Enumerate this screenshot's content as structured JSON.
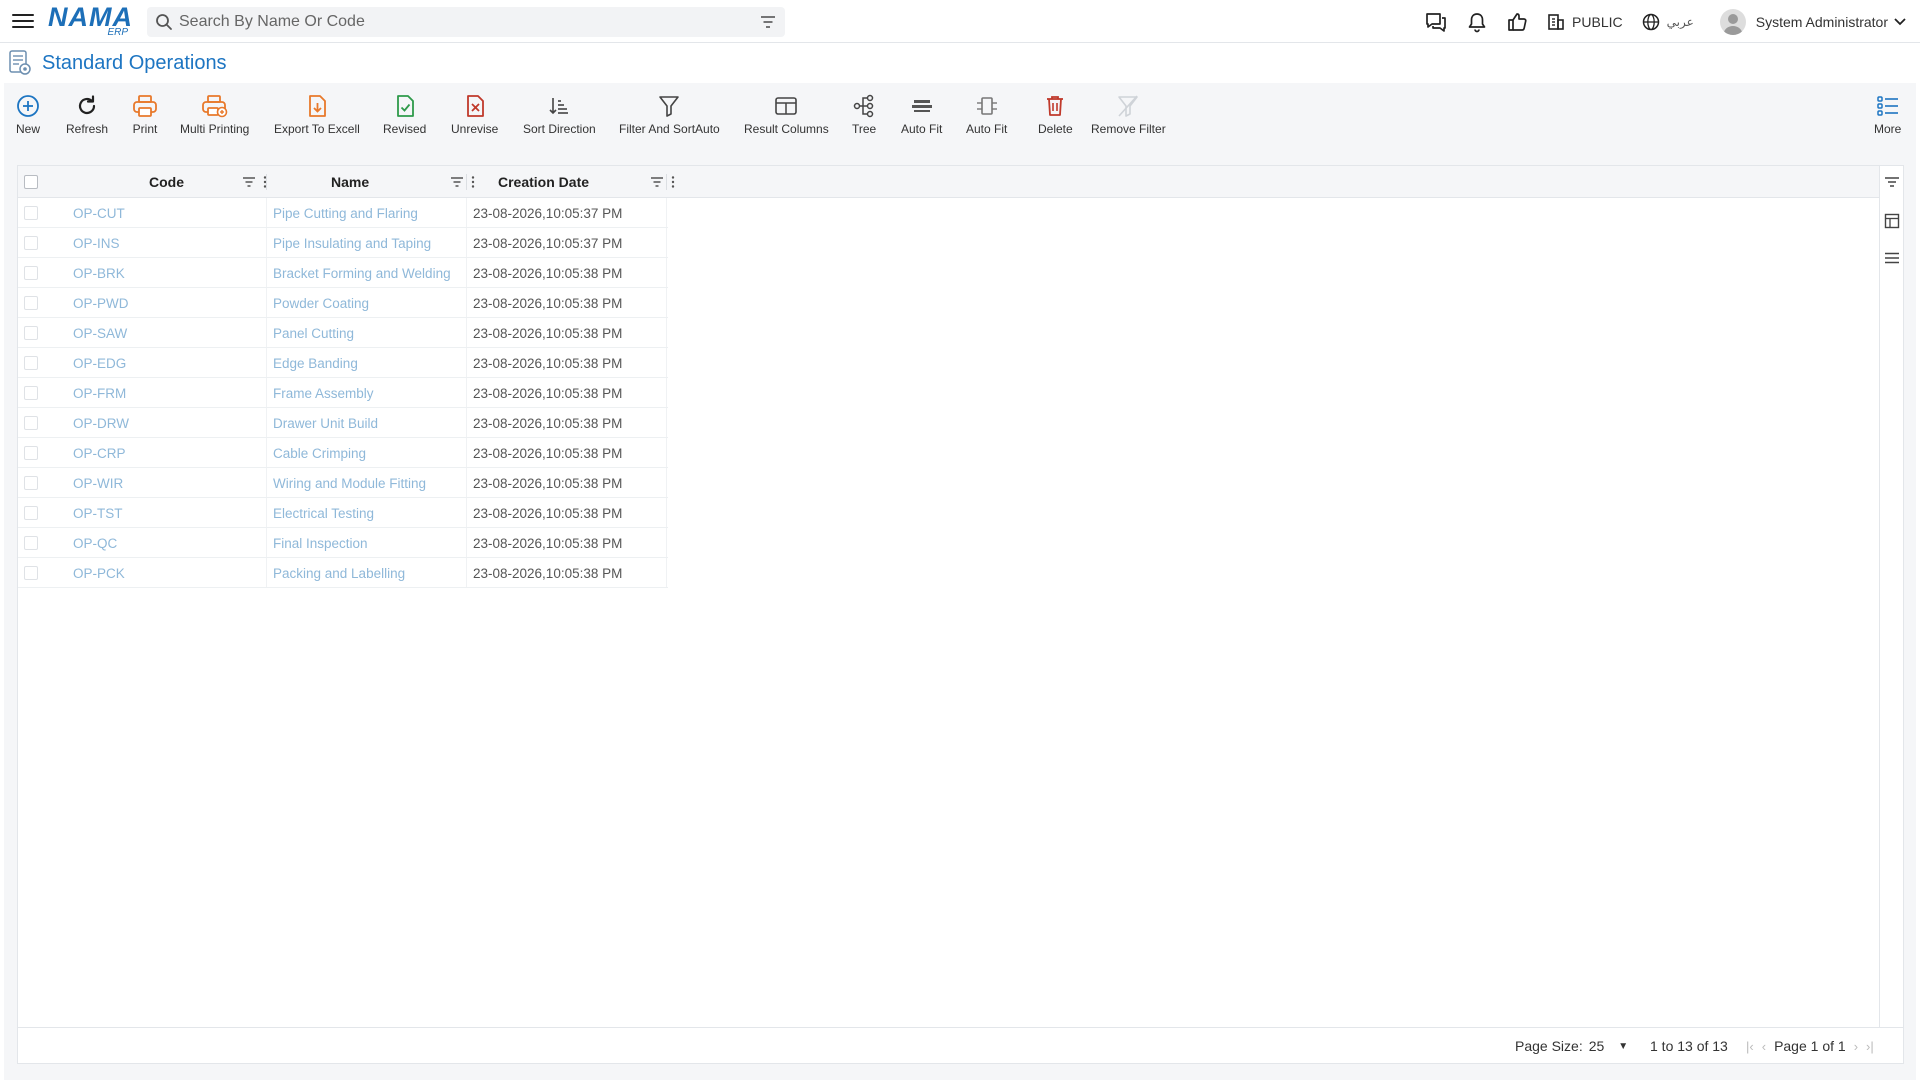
{
  "app": {
    "logo_text": "NAMA",
    "logo_sub": "ERP"
  },
  "search": {
    "placeholder": "Search By Name Or Code"
  },
  "topbar": {
    "company_label": "PUBLIC",
    "language_label": "عربي",
    "user_name": "System Administrator"
  },
  "page": {
    "title": "Standard Operations"
  },
  "toolbar": {
    "new": "New",
    "refresh": "Refresh",
    "print": "Print",
    "multi_printing": "Multi Printing",
    "export_excel": "Export To Excell",
    "revised": "Revised",
    "unrevise": "Unrevise",
    "sort_direction": "Sort Direction",
    "filter_sort": "Filter And SortAuto",
    "result_columns": "Result Columns",
    "tree": "Tree",
    "auto_fit_1": "Auto Fit",
    "auto_fit_2": "Auto Fit",
    "delete": "Delete",
    "remove_filter": "Remove Filter",
    "more": "More"
  },
  "grid": {
    "columns": [
      "Code",
      "Name",
      "Creation Date"
    ],
    "rows": [
      {
        "code": "OP-CUT",
        "name": "Pipe Cutting and Flaring",
        "date": "23-08-2026,10:05:37 PM"
      },
      {
        "code": "OP-INS",
        "name": "Pipe Insulating and Taping",
        "date": "23-08-2026,10:05:37 PM"
      },
      {
        "code": "OP-BRK",
        "name": "Bracket Forming and Welding",
        "date": "23-08-2026,10:05:38 PM"
      },
      {
        "code": "OP-PWD",
        "name": "Powder Coating",
        "date": "23-08-2026,10:05:38 PM"
      },
      {
        "code": "OP-SAW",
        "name": "Panel Cutting",
        "date": "23-08-2026,10:05:38 PM"
      },
      {
        "code": "OP-EDG",
        "name": "Edge Banding",
        "date": "23-08-2026,10:05:38 PM"
      },
      {
        "code": "OP-FRM",
        "name": "Frame Assembly",
        "date": "23-08-2026,10:05:38 PM"
      },
      {
        "code": "OP-DRW",
        "name": "Drawer Unit Build",
        "date": "23-08-2026,10:05:38 PM"
      },
      {
        "code": "OP-CRP",
        "name": "Cable Crimping",
        "date": "23-08-2026,10:05:38 PM"
      },
      {
        "code": "OP-WIR",
        "name": "Wiring and Module Fitting",
        "date": "23-08-2026,10:05:38 PM"
      },
      {
        "code": "OP-TST",
        "name": "Electrical Testing",
        "date": "23-08-2026,10:05:38 PM"
      },
      {
        "code": "OP-QC",
        "name": "Final Inspection",
        "date": "23-08-2026,10:05:38 PM"
      },
      {
        "code": "OP-PCK",
        "name": "Packing and Labelling",
        "date": "23-08-2026,10:05:38 PM"
      }
    ]
  },
  "footer": {
    "page_size_label": "Page Size:",
    "page_size_value": "25",
    "range_text": "1 to 13 of 13",
    "page_text": "Page 1 of 1"
  },
  "colors": {
    "brand": "#1d6fb8",
    "title": "#1d75c2",
    "link_dim": "#8fb8d9",
    "orange": "#e8792b",
    "green": "#2e9a4a",
    "red": "#c0392b"
  }
}
